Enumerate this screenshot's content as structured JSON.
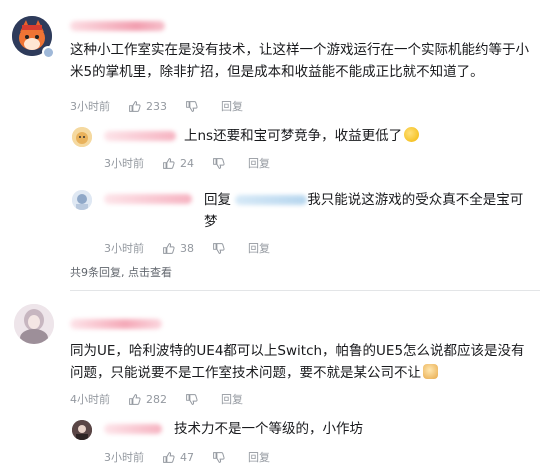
{
  "comments": [
    {
      "content": "这种小工作室实在是没有技术，让这样一个游戏运行在一个实际机能约等于小米5的掌机里，除非扩招，但是成本和收益能不能成正比就不知道了。",
      "time": "3小时前",
      "likes": "233",
      "reply_label": "回复",
      "replies": [
        {
          "content": "上ns还要和宝可梦竞争，收益更低了",
          "emoji": "sweat-smile-emoji",
          "time": "3小时前",
          "likes": "24",
          "reply_label": "回复"
        },
        {
          "reply_prefix": "回复",
          "content": "我只能说这游戏的受众真不全是宝可梦",
          "time": "3小时前",
          "likes": "38",
          "reply_label": "回复"
        }
      ],
      "more_replies": "共9条回复, 点击查看"
    },
    {
      "content": "同为UE，哈利波特的UE4都可以上Switch，帕鲁的UE5怎么说都应该是没有问题，只能说要不是工作室技术问题，要不就是某公司不让",
      "emoji": "dog-emoji",
      "time": "4小时前",
      "likes": "282",
      "reply_label": "回复",
      "replies": [
        {
          "content": "技术力不是一个等级的，小作坊",
          "time": "3小时前",
          "likes": "47",
          "reply_label": "回复"
        }
      ]
    }
  ],
  "colors": {
    "meta": "#9499a0",
    "text": "#18191c",
    "divider": "#e3e5e7",
    "name_blur": "#f4b6c2"
  }
}
